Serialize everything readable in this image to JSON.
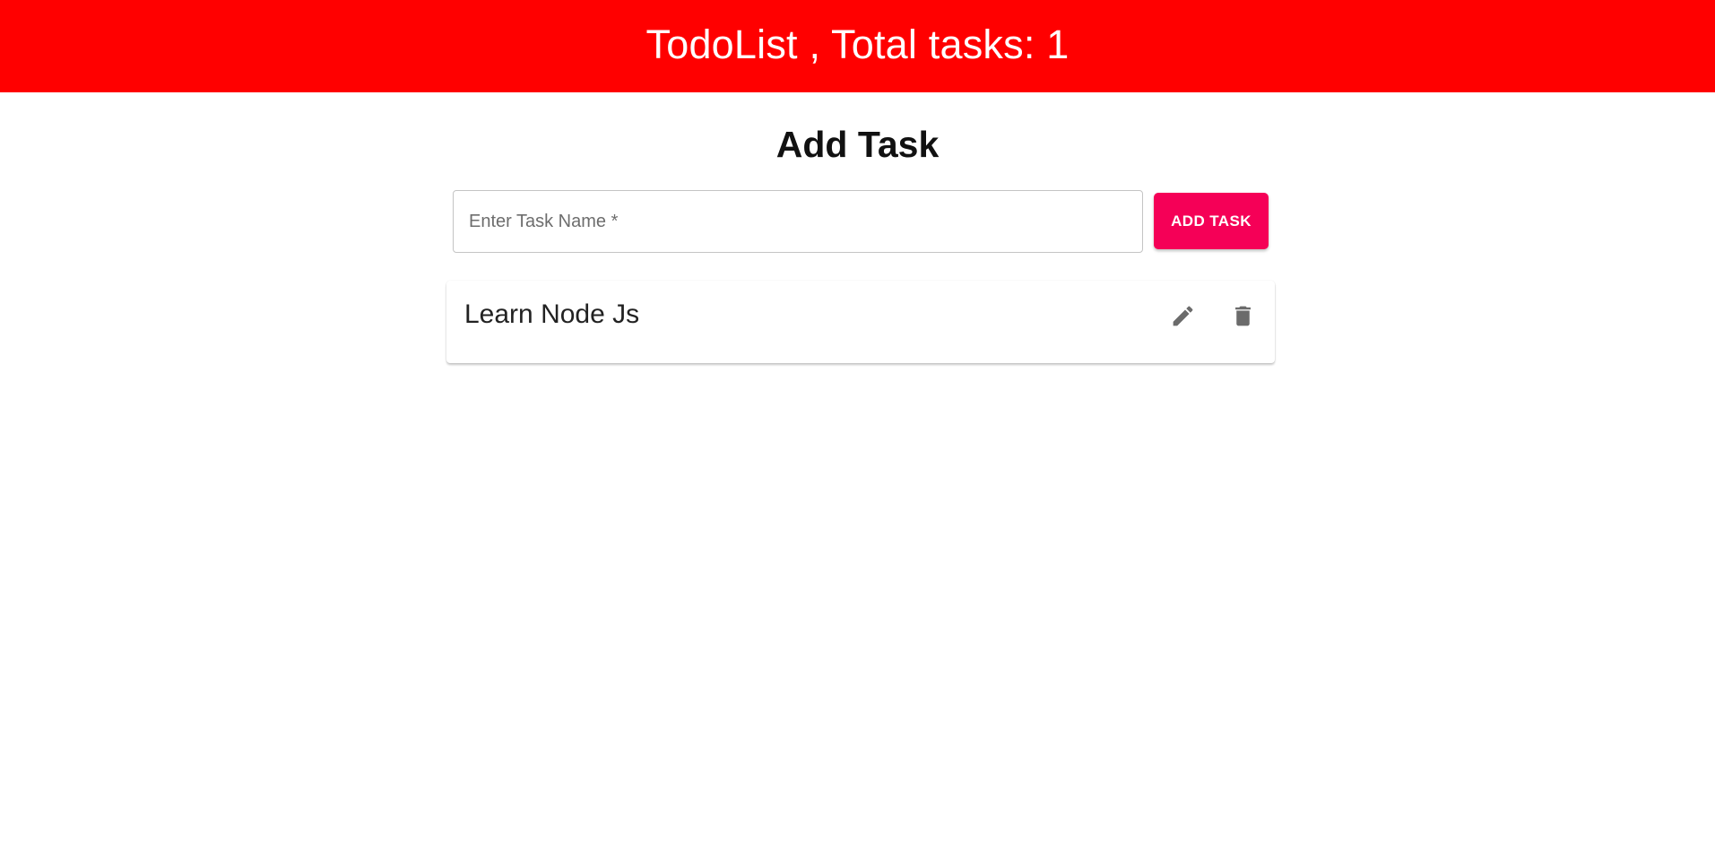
{
  "header": {
    "title": "TodoList , Total tasks: 1",
    "background_color": "#ff0000"
  },
  "add_task": {
    "heading": "Add Task",
    "input_placeholder": "Enter Task Name *",
    "input_value": "",
    "button_label": "ADD TASK",
    "button_color": "#f50057"
  },
  "tasks": [
    {
      "name": "Learn Node Js",
      "edit_icon": "pencil-icon",
      "delete_icon": "trash-icon"
    }
  ]
}
